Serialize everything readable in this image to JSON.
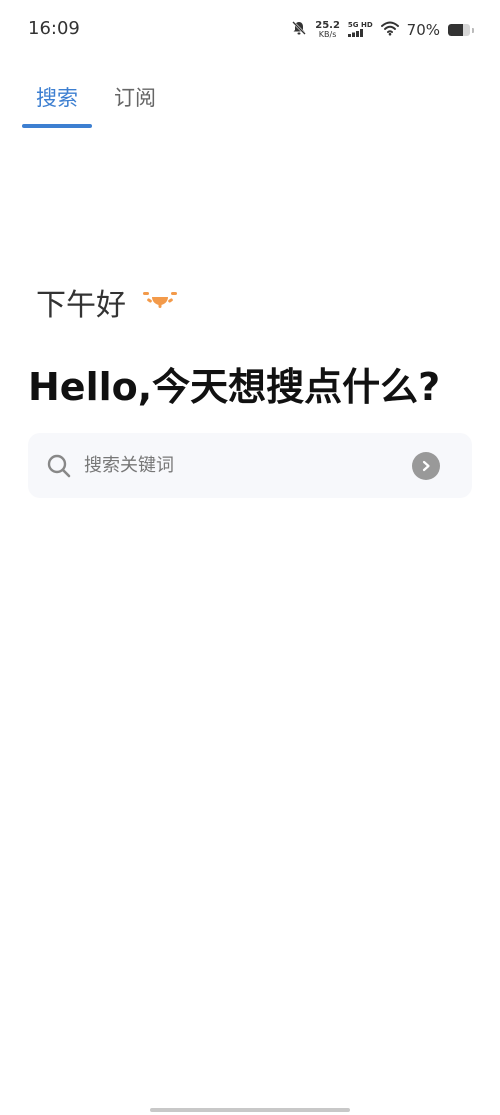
{
  "status_bar": {
    "time": "16:09",
    "net_speed_value": "25.2",
    "net_speed_unit": "KB/s",
    "net_type": "5G HD",
    "battery_percent_text": "70%",
    "battery_level": 0.7,
    "icons": [
      "silent-icon",
      "signal-icon",
      "wifi-icon",
      "battery-icon"
    ]
  },
  "tabs": [
    {
      "label": "搜索",
      "active": true
    },
    {
      "label": "订阅",
      "active": false
    }
  ],
  "greeting": {
    "text": "下午好",
    "icon": "sun-icon",
    "icon_color": "#f39a4a"
  },
  "headline": "Hello,今天想搜点什么?",
  "search": {
    "placeholder": "搜索关键词",
    "value": "",
    "search_icon": "search-icon",
    "go_icon": "arrow-right-circle-icon"
  },
  "colors": {
    "accent": "#3d7fd1",
    "search_bg": "#f7f8fb",
    "go_button": "#999999"
  }
}
